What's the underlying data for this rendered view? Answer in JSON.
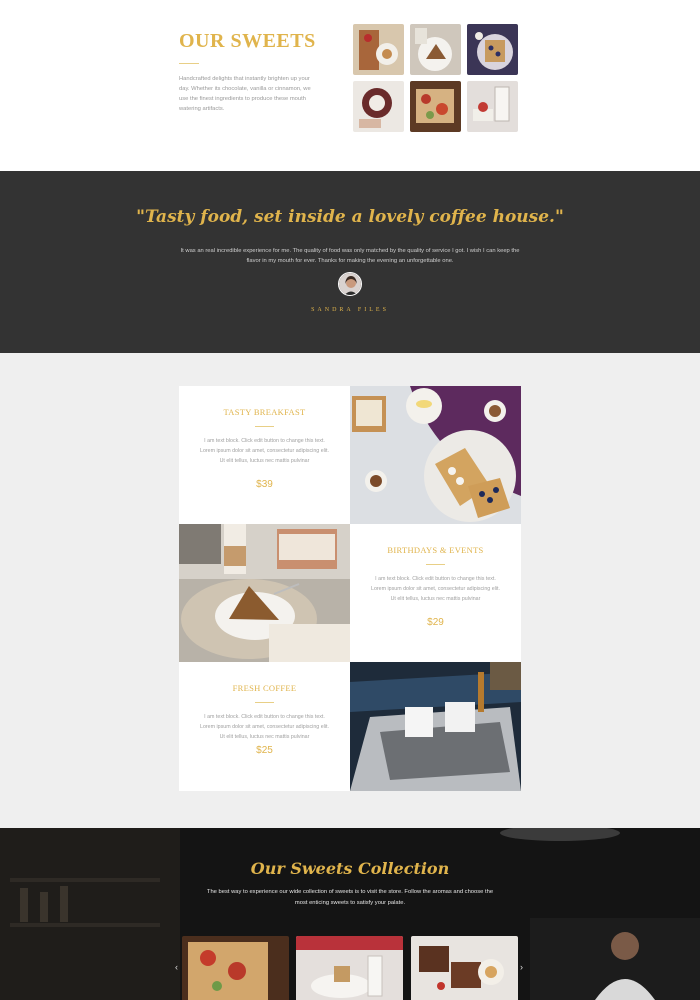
{
  "sweets": {
    "title": "OUR SWEETS",
    "description": "Handcrafted delights that instantly brighten up your day. Whether its chocolate, vanilla or cinnamon, we use the finest ingredients to produce these mouth watering artifacts."
  },
  "testimonial": {
    "quote": "\"Tasty food, set inside a lovely coffee house.\"",
    "text": "It was an real incredible experience for me. The quality of food was only matched by the quality of service I got. I wish I can keep the flavor in my mouth for ever. Thanks for making the evening an unforgettable one.",
    "author": "SANDRA FILES"
  },
  "menu": {
    "items": [
      {
        "title": "TASTY BREAKFAST",
        "text": "I am text block. Click edit button to change this text. Lorem ipsum dolor sit amet, consectetur adipiscing elit. Ut elit tellus, luctus nec mattis pulvinar",
        "price": "$39"
      },
      {
        "title": "BIRTHDAYS & EVENTS",
        "text": "I am text block. Click edit button to change this text. Lorem ipsum dolor sit amet, consectetur adipiscing elit. Ut elit tellus, luctus nec mattis pulvinar",
        "price": "$29"
      },
      {
        "title": "FRESH COFFEE",
        "text": "I am text block. Click edit button to change this text. Lorem ipsum dolor sit amet, consectetur adipiscing elit. Ut elit tellus, luctus nec mattis pulvinar",
        "price": "$25"
      }
    ]
  },
  "collection": {
    "title": "Our Sweets Collection",
    "text": "The best way to experience our wide collection of sweets is to visit the store. Follow the aromas and choose the most enticing sweets to satisfy your palate.",
    "prev_icon": "chevron-left-icon",
    "next_icon": "chevron-right-icon",
    "prev_glyph": "‹",
    "next_glyph": "›"
  },
  "colors": {
    "accent": "#e0b44c",
    "dark_band": "#333333",
    "menu_bg": "#efefef"
  }
}
